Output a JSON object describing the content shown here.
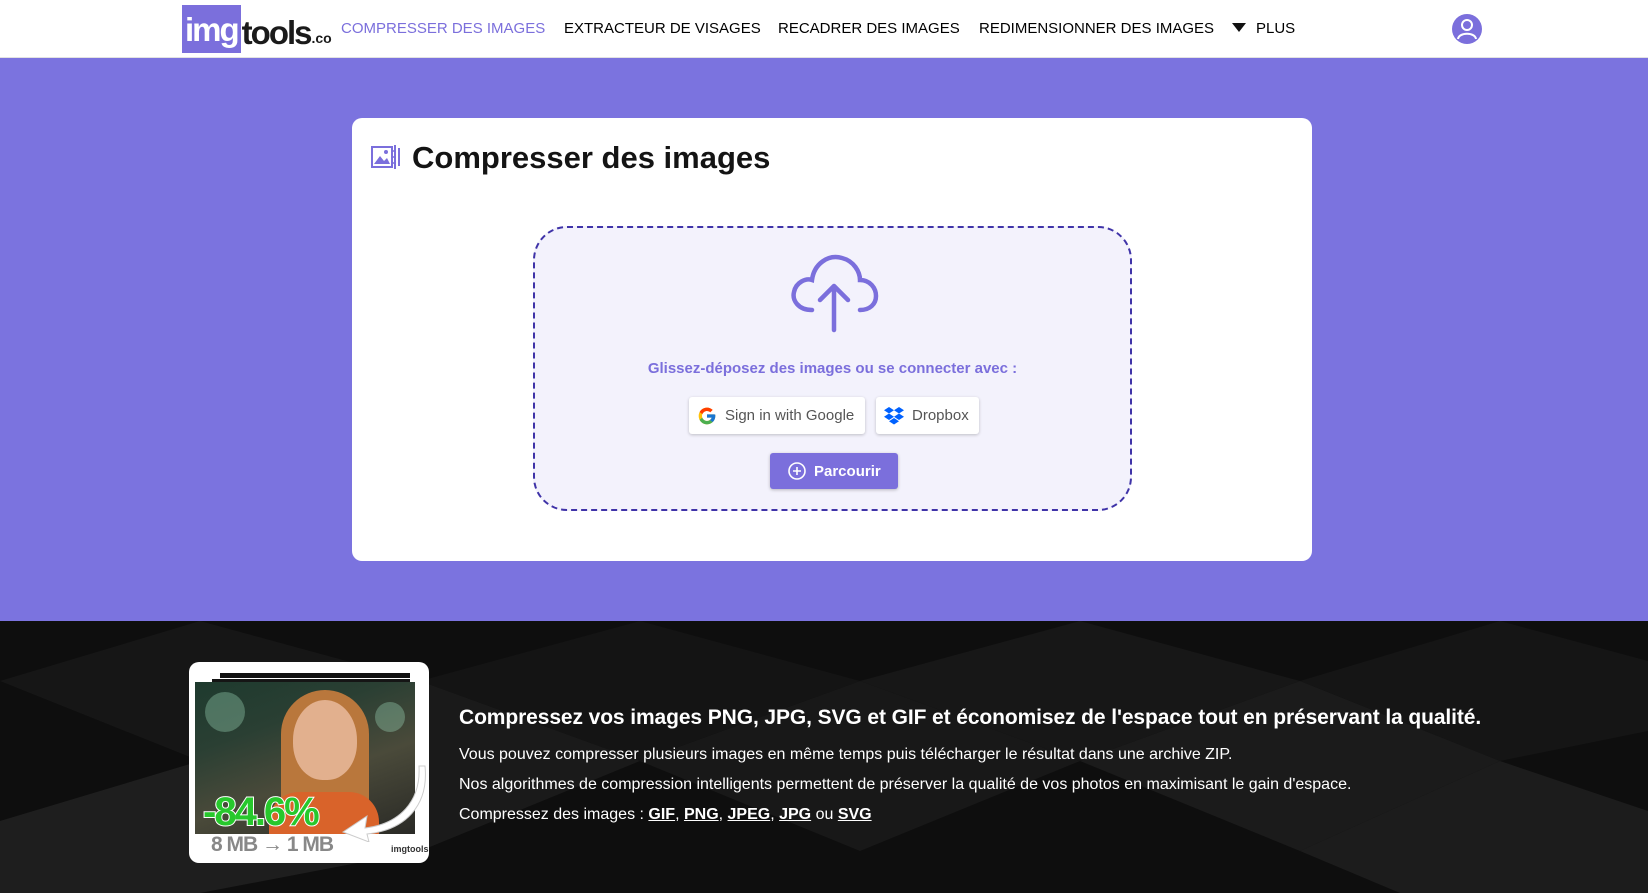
{
  "header": {
    "logo": {
      "img": "img",
      "tools": "tools",
      "co": ".co"
    },
    "nav": [
      {
        "label": "COMPRESSER DES IMAGES",
        "active": true
      },
      {
        "label": "EXTRACTEUR DE VISAGES",
        "active": false
      },
      {
        "label": "RECADRER DES IMAGES",
        "active": false
      },
      {
        "label": "REDIMENSIONNER DES IMAGES",
        "active": false
      }
    ],
    "more_label": "PLUS",
    "user_icon": "user-icon"
  },
  "main": {
    "title": "Compresser des images",
    "title_icon": "compress-images-icon",
    "dropzone": {
      "icon": "cloud-upload-icon",
      "instruction": "Glissez-déposez des images ou se connecter avec :",
      "google_label": "Sign in with Google",
      "dropbox_label": "Dropbox",
      "browse_label": "Parcourir"
    }
  },
  "promo": {
    "image": {
      "percent": "-84.6%",
      "sizes": "8 MB → 1 MB",
      "logo": "imgtools.co"
    },
    "heading": "Compressez vos images PNG, JPG, SVG et GIF et économisez de l'espace tout en préservant la qualité.",
    "line1": "Vous pouvez compresser plusieurs images en même temps puis télécharger le résultat dans une archive ZIP.",
    "line2": "Nos algorithmes de compression intelligents permettent de préserver la qualité de vos photos en maximisant le gain d'espace.",
    "formats_prefix": "Compressez des images : ",
    "formats": [
      "GIF",
      "PNG",
      "JPEG",
      "JPG",
      "SVG"
    ],
    "sep_comma": ", ",
    "sep_or": " ou "
  },
  "colors": {
    "accent": "#7b6fdc",
    "band": "#7b73df",
    "dark": "#0e0e0e",
    "green": "#27c82c"
  }
}
